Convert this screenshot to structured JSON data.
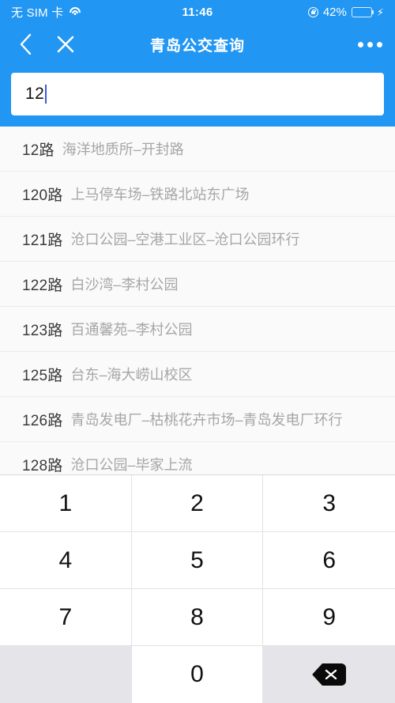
{
  "status_bar": {
    "carrier": "无 SIM 卡",
    "wifi_icon": "wifi-icon",
    "time": "11:46",
    "orientation_lock_icon": "rotation-lock-icon",
    "battery_percent": "42%",
    "battery_level": 42,
    "charging_icon": "⚡"
  },
  "nav": {
    "back_icon": "chevron-left-icon",
    "close_icon": "close-icon",
    "title": "青岛公交查询",
    "more_icon": "more-dots-icon"
  },
  "search": {
    "value": "12",
    "placeholder": ""
  },
  "results": [
    {
      "number": "12路",
      "desc": "海洋地质所–开封路"
    },
    {
      "number": "120路",
      "desc": "上马停车场–铁路北站东广场"
    },
    {
      "number": "121路",
      "desc": "沧口公园–空港工业区–沧口公园环行"
    },
    {
      "number": "122路",
      "desc": "白沙湾–李村公园"
    },
    {
      "number": "123路",
      "desc": "百通馨苑–李村公园"
    },
    {
      "number": "125路",
      "desc": "台东–海大崂山校区"
    },
    {
      "number": "126路",
      "desc": "青岛发电厂–枯桃花卉市场–青岛发电厂环行"
    },
    {
      "number": "128路",
      "desc": "沧口公园–毕家上流"
    }
  ],
  "keyboard": {
    "keys": [
      "1",
      "2",
      "3",
      "4",
      "5",
      "6",
      "7",
      "8",
      "9"
    ],
    "blank_label": "",
    "zero_label": "0",
    "backspace_icon": "backspace-icon"
  },
  "colors": {
    "accent": "#2196f3",
    "battery_green": "#4cd964",
    "caret": "#3b5bdb",
    "list_bg": "#fafafa",
    "key_gray": "#e5e5e9"
  }
}
